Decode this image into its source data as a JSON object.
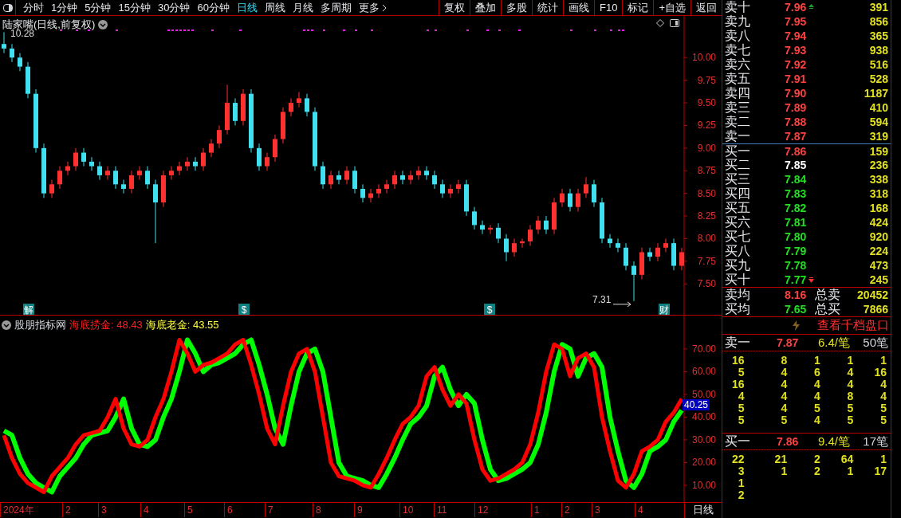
{
  "toolbar": {
    "periods": [
      {
        "label": "分时",
        "selected": false
      },
      {
        "label": "1分钟",
        "selected": false
      },
      {
        "label": "5分钟",
        "selected": false
      },
      {
        "label": "15分钟",
        "selected": false
      },
      {
        "label": "30分钟",
        "selected": false
      },
      {
        "label": "60分钟",
        "selected": false
      },
      {
        "label": "日线",
        "selected": true
      },
      {
        "label": "周线",
        "selected": false
      },
      {
        "label": "月线",
        "selected": false
      },
      {
        "label": "多周期",
        "selected": false
      }
    ],
    "more": "更多",
    "buttons": [
      "复权",
      "叠加",
      "多股",
      "统计",
      "画线",
      "F10",
      "标记",
      "+自选",
      "返回"
    ]
  },
  "price_chart": {
    "title": "陆家嘴(日线,前复权)",
    "high_label": "10.28",
    "low_label": "7.31",
    "events": [
      "解",
      "$",
      "$",
      "财"
    ],
    "chart_data": {
      "type": "candlestick",
      "categories": [
        null,
        null,
        null,
        null,
        null,
        null,
        null,
        null,
        null,
        null,
        null,
        null,
        null,
        null,
        null,
        null,
        null,
        null,
        null,
        null,
        null,
        null,
        null,
        null,
        null,
        null,
        null,
        null,
        null,
        null,
        null,
        null,
        null,
        null,
        null,
        null,
        null,
        null,
        null,
        null,
        null,
        null,
        null,
        null,
        null,
        null,
        null,
        null,
        null,
        null,
        null,
        null,
        null,
        null,
        null,
        null,
        null,
        null,
        null,
        null,
        null,
        null,
        null,
        null,
        null,
        null,
        null,
        null,
        null,
        null,
        null,
        null,
        null,
        null,
        null,
        null,
        null,
        null,
        null,
        null,
        null,
        null,
        null,
        null,
        null,
        null
      ],
      "ohlc": [
        [
          10.15,
          10.28,
          10.05,
          10.1
        ],
        [
          10.1,
          10.15,
          9.95,
          10.0
        ],
        [
          10.0,
          10.05,
          9.85,
          9.9
        ],
        [
          9.9,
          9.95,
          9.55,
          9.6
        ],
        [
          9.6,
          9.65,
          8.95,
          9.0
        ],
        [
          9.0,
          9.05,
          8.45,
          8.5
        ],
        [
          8.5,
          8.65,
          8.45,
          8.6
        ],
        [
          8.6,
          8.8,
          8.55,
          8.75
        ],
        [
          8.75,
          8.85,
          8.7,
          8.8
        ],
        [
          8.8,
          9.0,
          8.75,
          8.95
        ],
        [
          8.95,
          9.0,
          8.8,
          8.85
        ],
        [
          8.85,
          8.9,
          8.75,
          8.8
        ],
        [
          8.8,
          8.85,
          8.65,
          8.7
        ],
        [
          8.7,
          8.8,
          8.65,
          8.75
        ],
        [
          8.75,
          8.8,
          8.55,
          8.6
        ],
        [
          8.6,
          8.65,
          8.5,
          8.55
        ],
        [
          8.55,
          8.75,
          8.5,
          8.7
        ],
        [
          8.7,
          8.8,
          8.65,
          8.75
        ],
        [
          8.75,
          8.8,
          8.55,
          8.6
        ],
        [
          8.6,
          8.65,
          7.95,
          8.4
        ],
        [
          8.4,
          8.75,
          8.35,
          8.7
        ],
        [
          8.7,
          8.8,
          8.65,
          8.75
        ],
        [
          8.75,
          8.85,
          8.7,
          8.8
        ],
        [
          8.8,
          8.9,
          8.75,
          8.85
        ],
        [
          8.85,
          8.9,
          8.75,
          8.8
        ],
        [
          8.8,
          9.0,
          8.75,
          8.95
        ],
        [
          8.95,
          9.1,
          8.9,
          9.05
        ],
        [
          9.05,
          9.25,
          9.0,
          9.2
        ],
        [
          9.2,
          9.7,
          9.15,
          9.5
        ],
        [
          9.5,
          9.55,
          9.25,
          9.3
        ],
        [
          9.3,
          9.65,
          9.25,
          9.6
        ],
        [
          9.6,
          9.65,
          8.95,
          9.0
        ],
        [
          9.0,
          9.05,
          8.75,
          8.8
        ],
        [
          8.8,
          8.95,
          8.75,
          8.9
        ],
        [
          8.9,
          9.15,
          8.85,
          9.1
        ],
        [
          9.1,
          9.45,
          9.05,
          9.4
        ],
        [
          9.4,
          9.55,
          9.35,
          9.5
        ],
        [
          9.5,
          9.62,
          9.45,
          9.55
        ],
        [
          9.55,
          9.6,
          9.35,
          9.4
        ],
        [
          9.4,
          9.45,
          8.75,
          8.8
        ],
        [
          8.8,
          8.85,
          8.55,
          8.6
        ],
        [
          8.6,
          8.75,
          8.55,
          8.7
        ],
        [
          8.7,
          8.75,
          8.6,
          8.65
        ],
        [
          8.65,
          8.8,
          8.6,
          8.75
        ],
        [
          8.75,
          8.8,
          8.5,
          8.55
        ],
        [
          8.55,
          8.6,
          8.4,
          8.45
        ],
        [
          8.45,
          8.55,
          8.4,
          8.5
        ],
        [
          8.5,
          8.6,
          8.45,
          8.55
        ],
        [
          8.55,
          8.65,
          8.5,
          8.6
        ],
        [
          8.6,
          8.75,
          8.55,
          8.7
        ],
        [
          8.7,
          8.75,
          8.6,
          8.65
        ],
        [
          8.65,
          8.75,
          8.6,
          8.7
        ],
        [
          8.7,
          8.8,
          8.65,
          8.75
        ],
        [
          8.75,
          8.8,
          8.65,
          8.7
        ],
        [
          8.7,
          8.75,
          8.55,
          8.6
        ],
        [
          8.6,
          8.65,
          8.45,
          8.5
        ],
        [
          8.5,
          8.6,
          8.45,
          8.55
        ],
        [
          8.55,
          8.65,
          8.5,
          8.6
        ],
        [
          8.6,
          8.65,
          8.25,
          8.3
        ],
        [
          8.3,
          8.35,
          8.1,
          8.15
        ],
        [
          8.15,
          8.2,
          8.05,
          8.1
        ],
        [
          8.1,
          8.15,
          8.05,
          8.12
        ],
        [
          8.12,
          8.17,
          7.95,
          8.0
        ],
        [
          8.0,
          8.05,
          7.75,
          7.85
        ],
        [
          7.85,
          8.0,
          7.8,
          7.95
        ],
        [
          7.95,
          8.0,
          7.9,
          7.97
        ],
        [
          7.97,
          8.15,
          7.92,
          8.1
        ],
        [
          8.1,
          8.25,
          8.05,
          8.2
        ],
        [
          8.2,
          8.25,
          8.05,
          8.1
        ],
        [
          8.1,
          8.45,
          8.05,
          8.4
        ],
        [
          8.4,
          8.55,
          8.35,
          8.5
        ],
        [
          8.5,
          8.55,
          8.3,
          8.35
        ],
        [
          8.35,
          8.55,
          8.3,
          8.5
        ],
        [
          8.5,
          8.68,
          8.45,
          8.6
        ],
        [
          8.6,
          8.65,
          8.35,
          8.4
        ],
        [
          8.4,
          8.45,
          7.95,
          8.0
        ],
        [
          8.0,
          8.05,
          7.9,
          7.95
        ],
        [
          7.95,
          8.0,
          7.85,
          7.9
        ],
        [
          7.9,
          7.95,
          7.65,
          7.7
        ],
        [
          7.7,
          7.75,
          7.31,
          7.6
        ],
        [
          7.6,
          7.9,
          7.55,
          7.85
        ],
        [
          7.85,
          7.9,
          7.75,
          7.8
        ],
        [
          7.8,
          7.95,
          7.75,
          7.9
        ],
        [
          7.9,
          8.0,
          7.85,
          7.95
        ],
        [
          7.95,
          8.0,
          7.65,
          7.7
        ],
        [
          7.7,
          7.9,
          7.65,
          7.85
        ]
      ],
      "yticks": [
        {
          "value": 10,
          "label": "10.00"
        },
        {
          "value": 9.75,
          "label": "9.75"
        },
        {
          "value": 9.5,
          "label": "9.50"
        },
        {
          "value": 9.25,
          "label": "9.25"
        },
        {
          "value": 9,
          "label": "9.00"
        },
        {
          "value": 8.75,
          "label": "8.75"
        },
        {
          "value": 8.5,
          "label": "8.50"
        },
        {
          "value": 8.25,
          "label": "8.25"
        },
        {
          "value": 8,
          "label": "8.00"
        },
        {
          "value": 7.75,
          "label": "7.75"
        },
        {
          "value": 7.5,
          "label": "7.50"
        }
      ],
      "ylim": [
        7.15,
        10.46
      ]
    }
  },
  "indicator": {
    "name": "股朋指标网",
    "readings": [
      {
        "label": "海底捞金:",
        "value": "48.43",
        "color": "#ff2020"
      },
      {
        "label": "海底老金:",
        "value": "43.55",
        "color": "#ffff40"
      }
    ],
    "current": "40.25",
    "chart_data": {
      "type": "line",
      "series": [
        {
          "color": "#ff0000",
          "values": [
            32,
            22,
            15,
            11,
            9,
            7,
            14,
            18,
            22,
            28,
            32,
            33,
            34,
            40,
            48,
            35,
            28,
            27,
            30,
            40,
            48,
            60,
            74,
            68,
            60,
            63,
            64,
            66,
            68,
            72,
            74,
            63,
            50,
            35,
            28,
            45,
            60,
            68,
            70,
            60,
            40,
            20,
            14,
            13,
            12,
            10,
            9,
            15,
            22,
            30,
            37,
            40,
            45,
            58,
            62,
            52,
            45,
            50,
            46,
            30,
            17,
            12,
            13,
            15,
            17,
            20,
            28,
            42,
            60,
            72,
            70,
            58,
            66,
            68,
            62,
            40,
            25,
            12,
            9,
            15,
            25,
            27,
            30,
            38,
            42,
            48
          ]
        },
        {
          "color": "#00ff00",
          "values": [
            34,
            32,
            22,
            15,
            11,
            9,
            7,
            14,
            18,
            22,
            28,
            32,
            33,
            34,
            40,
            48,
            35,
            28,
            27,
            30,
            40,
            48,
            60,
            74,
            68,
            60,
            63,
            64,
            66,
            68,
            72,
            74,
            63,
            50,
            35,
            28,
            45,
            60,
            68,
            70,
            60,
            40,
            20,
            14,
            13,
            12,
            10,
            9,
            15,
            22,
            30,
            37,
            40,
            45,
            58,
            62,
            52,
            45,
            50,
            46,
            30,
            17,
            12,
            13,
            15,
            17,
            20,
            28,
            42,
            60,
            72,
            70,
            58,
            66,
            68,
            62,
            40,
            25,
            12,
            9,
            15,
            25,
            27,
            30,
            38,
            43
          ]
        }
      ],
      "yticks": [
        {
          "value": 70,
          "label": "70.00"
        },
        {
          "value": 60,
          "label": "60.00"
        },
        {
          "value": 50,
          "label": "50.00"
        },
        {
          "value": 40,
          "label": "40.00"
        },
        {
          "value": 30,
          "label": "30.00"
        },
        {
          "value": 20,
          "label": "20.00"
        },
        {
          "value": 10,
          "label": "10.00"
        }
      ],
      "ylim": [
        2.6,
        84.7
      ]
    }
  },
  "date_axis": {
    "labels": [
      "2024年",
      "2",
      "3",
      "4",
      "5",
      "6",
      "7",
      "8",
      "9",
      "10",
      "11",
      "12",
      "1",
      "2",
      "3",
      "4"
    ],
    "period": "日线"
  },
  "order_book": {
    "levels": [
      {
        "label": "卖十",
        "price": "7.96",
        "volume": "391",
        "color": "#ff4040",
        "up_flag": true
      },
      {
        "label": "卖九",
        "price": "7.95",
        "volume": "856",
        "color": "#ff4040"
      },
      {
        "label": "卖八",
        "price": "7.94",
        "volume": "365",
        "color": "#ff4040"
      },
      {
        "label": "卖七",
        "price": "7.93",
        "volume": "938",
        "color": "#ff4040"
      },
      {
        "label": "卖六",
        "price": "7.92",
        "volume": "516",
        "color": "#ff4040"
      },
      {
        "label": "卖五",
        "price": "7.91",
        "volume": "528",
        "color": "#ff4040"
      },
      {
        "label": "卖四",
        "price": "7.90",
        "volume": "1187",
        "color": "#ff4040"
      },
      {
        "label": "卖三",
        "price": "7.89",
        "volume": "410",
        "color": "#ff4040"
      },
      {
        "label": "卖二",
        "price": "7.88",
        "volume": "594",
        "color": "#ff4040"
      },
      {
        "label": "卖一",
        "price": "7.87",
        "volume": "319",
        "color": "#ff4040"
      },
      {
        "label": "买一",
        "price": "7.86",
        "volume": "159",
        "color": "#ff4040"
      },
      {
        "label": "买二",
        "price": "7.85",
        "volume": "236",
        "color": "#ffffff"
      },
      {
        "label": "买三",
        "price": "7.84",
        "volume": "338",
        "color": "#20e020"
      },
      {
        "label": "买四",
        "price": "7.83",
        "volume": "318",
        "color": "#20e020"
      },
      {
        "label": "买五",
        "price": "7.82",
        "volume": "168",
        "color": "#20e020"
      },
      {
        "label": "买六",
        "price": "7.81",
        "volume": "424",
        "color": "#20e020"
      },
      {
        "label": "买七",
        "price": "7.80",
        "volume": "920",
        "color": "#20e020"
      },
      {
        "label": "买八",
        "price": "7.79",
        "volume": "224",
        "color": "#20e020"
      },
      {
        "label": "买九",
        "price": "7.78",
        "volume": "473",
        "color": "#20e020"
      },
      {
        "label": "买十",
        "price": "7.77",
        "volume": "245",
        "color": "#20e020",
        "down_flag": true
      }
    ],
    "summary": [
      {
        "label": "卖均",
        "price": "8.16",
        "color": "#ff4040",
        "total_label": "总卖",
        "total": "20452"
      },
      {
        "label": "买均",
        "price": "7.65",
        "color": "#20e020",
        "total_label": "总买",
        "total": "7866"
      }
    ]
  },
  "queue": {
    "link": "查看千档盘口",
    "blocks": [
      {
        "label": "卖一",
        "price": "7.87",
        "average": "6.4/笔",
        "count": "50笔",
        "rows": [
          [
            "16",
            "8",
            "1",
            "1",
            "1"
          ],
          [
            "5",
            "4",
            "6",
            "4",
            "16"
          ],
          [
            "16",
            "4",
            "4",
            "4",
            "4"
          ],
          [
            "4",
            "4",
            "4",
            "8",
            "4"
          ],
          [
            "5",
            "4",
            "5",
            "5",
            "5"
          ],
          [
            "5",
            "5",
            "4",
            "5",
            "5"
          ]
        ]
      },
      {
        "label": "买一",
        "price": "7.86",
        "average": "9.4/笔",
        "count": "17笔",
        "rows": [
          [
            "22",
            "21",
            "2",
            "64",
            "1"
          ],
          [
            "3",
            "1",
            "2",
            "1",
            "17"
          ],
          [
            "1"
          ],
          [
            "2"
          ]
        ]
      }
    ]
  }
}
